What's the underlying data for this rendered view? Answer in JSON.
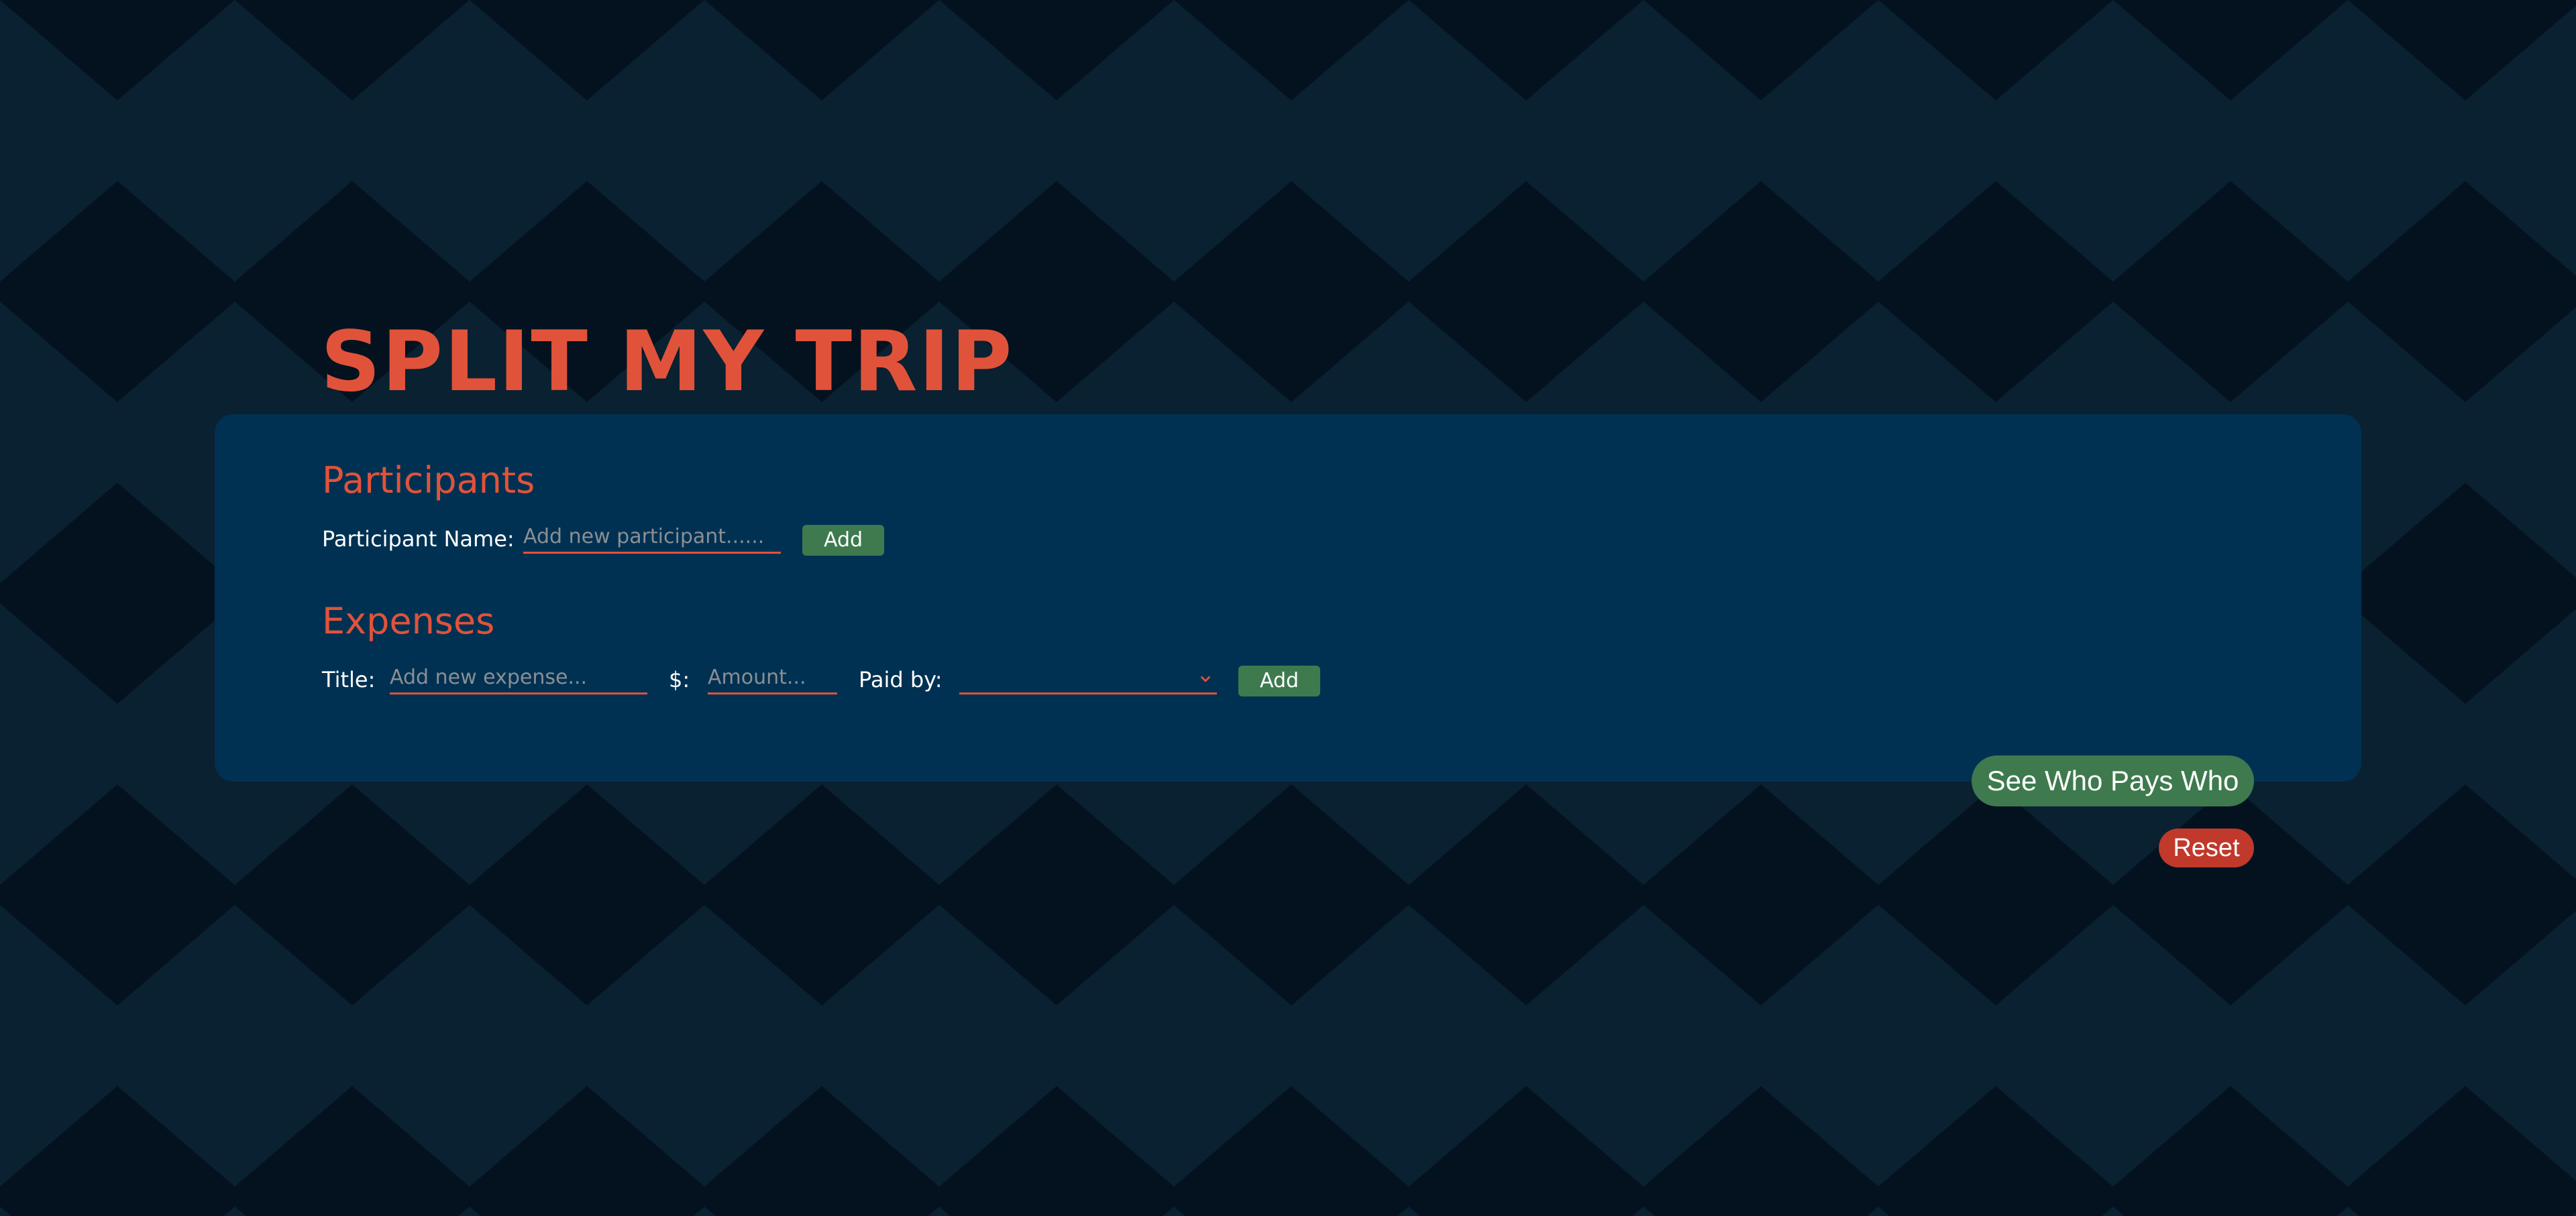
{
  "app": {
    "title": "SPLIT MY TRIP"
  },
  "participants": {
    "heading": "Participants",
    "name_label": "Participant Name:",
    "name_placeholder": "Add new participant......",
    "name_value": "",
    "add_label": "Add"
  },
  "expenses": {
    "heading": "Expenses",
    "title_label": "Title:",
    "title_placeholder": "Add new expense...",
    "title_value": "",
    "amount_label": "$:",
    "amount_placeholder": "Amount...",
    "amount_value": "",
    "paid_by_label": "Paid by:",
    "paid_by_selected": "",
    "add_label": "Add"
  },
  "actions": {
    "see_who_pays_label": "See Who Pays Who",
    "reset_label": "Reset"
  },
  "icons": {
    "select_chevron": "chevron-down-icon"
  },
  "colors": {
    "background": "#04121f",
    "pattern": "#0a2132",
    "panel": "#003152",
    "accent": "#e0533a",
    "button_green": "#3e7a4e",
    "button_red": "#c0392b",
    "text": "#ffffff",
    "placeholder": "#8a8f93"
  }
}
